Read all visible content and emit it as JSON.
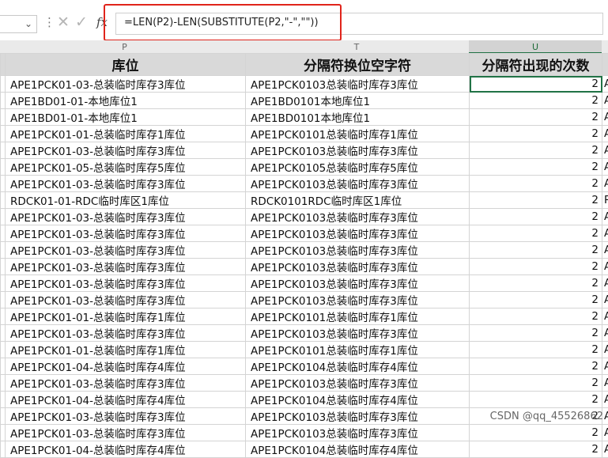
{
  "formula_bar": {
    "name_box_value": "",
    "fx_label": "fx",
    "formula": "=LEN(P2)-LEN(SUBSTITUTE(P2,\"-\",\"\"))",
    "cancel_icon": "x-icon",
    "confirm_icon": "check-icon"
  },
  "columns": {
    "letters": [
      "P",
      "T",
      "U"
    ],
    "headers": [
      "库位",
      "分隔符换位空字符",
      "分隔符出现的次数"
    ]
  },
  "rows": [
    {
      "p": "APE1PCK01-03-总装临时库存3库位",
      "t": "APE1PCK0103总装临时库存3库位",
      "u": "2",
      "v": "A"
    },
    {
      "p": "APE1BD01-01-本地库位1",
      "t": "APE1BD0101本地库位1",
      "u": "2",
      "v": "A"
    },
    {
      "p": "APE1BD01-01-本地库位1",
      "t": "APE1BD0101本地库位1",
      "u": "2",
      "v": "A"
    },
    {
      "p": "APE1PCK01-01-总装临时库存1库位",
      "t": "APE1PCK0101总装临时库存1库位",
      "u": "2",
      "v": "A"
    },
    {
      "p": "APE1PCK01-03-总装临时库存3库位",
      "t": "APE1PCK0103总装临时库存3库位",
      "u": "2",
      "v": "A"
    },
    {
      "p": "APE1PCK01-05-总装临时库存5库位",
      "t": "APE1PCK0105总装临时库存5库位",
      "u": "2",
      "v": "A"
    },
    {
      "p": "APE1PCK01-03-总装临时库存3库位",
      "t": "APE1PCK0103总装临时库存3库位",
      "u": "2",
      "v": "A"
    },
    {
      "p": "RDCK01-01-RDC临时库区1库位",
      "t": "RDCK0101RDC临时库区1库位",
      "u": "2",
      "v": "R"
    },
    {
      "p": "APE1PCK01-03-总装临时库存3库位",
      "t": "APE1PCK0103总装临时库存3库位",
      "u": "2",
      "v": "A"
    },
    {
      "p": "APE1PCK01-03-总装临时库存3库位",
      "t": "APE1PCK0103总装临时库存3库位",
      "u": "2",
      "v": "A"
    },
    {
      "p": "APE1PCK01-03-总装临时库存3库位",
      "t": "APE1PCK0103总装临时库存3库位",
      "u": "2",
      "v": "A"
    },
    {
      "p": "APE1PCK01-03-总装临时库存3库位",
      "t": "APE1PCK0103总装临时库存3库位",
      "u": "2",
      "v": "A"
    },
    {
      "p": "APE1PCK01-03-总装临时库存3库位",
      "t": "APE1PCK0103总装临时库存3库位",
      "u": "2",
      "v": "A"
    },
    {
      "p": "APE1PCK01-03-总装临时库存3库位",
      "t": "APE1PCK0103总装临时库存3库位",
      "u": "2",
      "v": "A"
    },
    {
      "p": "APE1PCK01-01-总装临时库存1库位",
      "t": "APE1PCK0101总装临时库存1库位",
      "u": "2",
      "v": "A"
    },
    {
      "p": "APE1PCK01-03-总装临时库存3库位",
      "t": "APE1PCK0103总装临时库存3库位",
      "u": "2",
      "v": "A"
    },
    {
      "p": "APE1PCK01-01-总装临时库存1库位",
      "t": "APE1PCK0101总装临时库存1库位",
      "u": "2",
      "v": "A"
    },
    {
      "p": "APE1PCK01-04-总装临时库存4库位",
      "t": "APE1PCK0104总装临时库存4库位",
      "u": "2",
      "v": "A"
    },
    {
      "p": "APE1PCK01-03-总装临时库存3库位",
      "t": "APE1PCK0103总装临时库存3库位",
      "u": "2",
      "v": "A"
    },
    {
      "p": "APE1PCK01-04-总装临时库存4库位",
      "t": "APE1PCK0104总装临时库存4库位",
      "u": "2",
      "v": "A"
    },
    {
      "p": "APE1PCK01-03-总装临时库存3库位",
      "t": "APE1PCK0103总装临时库存3库位",
      "u": "2",
      "v": "A"
    },
    {
      "p": "APE1PCK01-03-总装临时库存3库位",
      "t": "APE1PCK0103总装临时库存3库位",
      "u": "2",
      "v": "A"
    },
    {
      "p": "APE1PCK01-04-总装临时库存4库位",
      "t": "APE1PCK0104总装临时库存4库位",
      "u": "2",
      "v": "A"
    }
  ],
  "watermark": "CSDN @qq_45526862",
  "colors": {
    "highlight": "#e0241b",
    "selection": "#217346",
    "header_bg": "#d9d9d9"
  }
}
